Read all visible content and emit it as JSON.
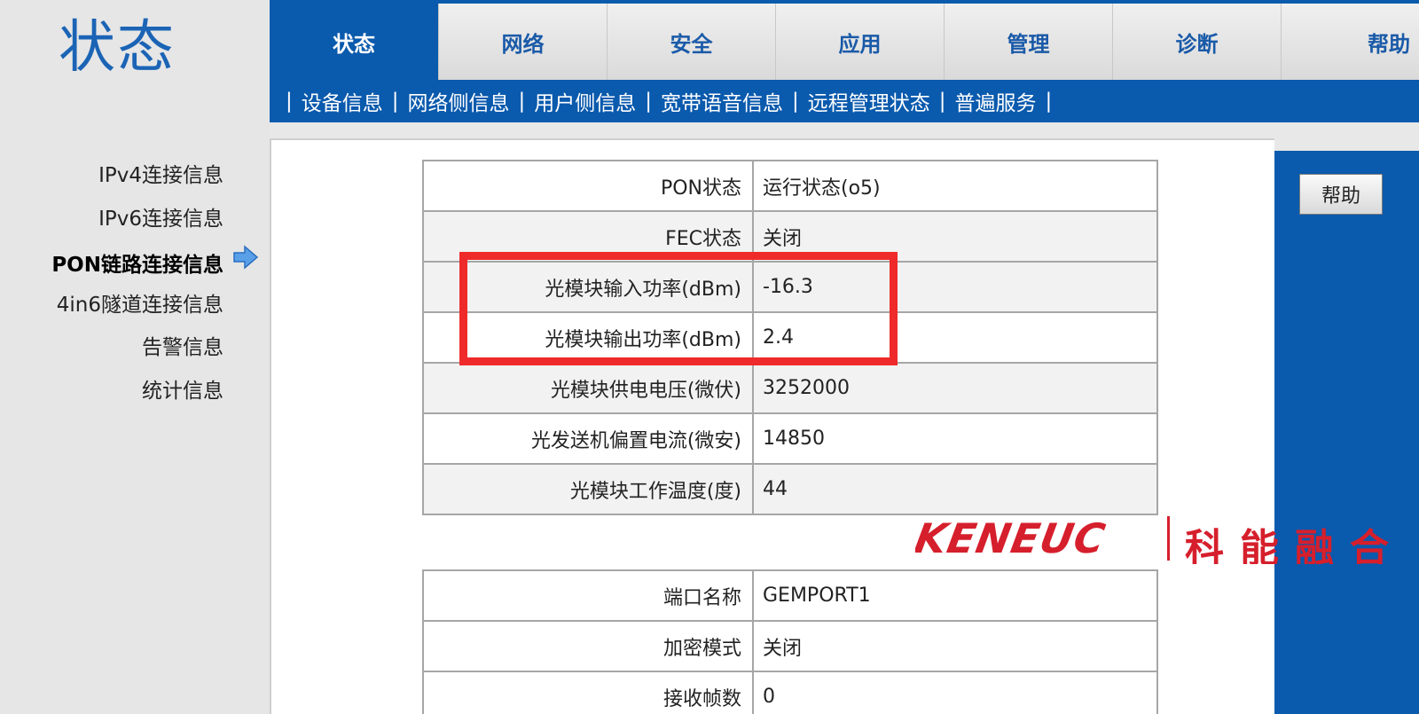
{
  "header": {
    "title": "状态",
    "tabs": [
      {
        "label": "状态",
        "active": true
      },
      {
        "label": "网络",
        "active": false
      },
      {
        "label": "安全",
        "active": false
      },
      {
        "label": "应用",
        "active": false
      },
      {
        "label": "管理",
        "active": false
      },
      {
        "label": "诊断",
        "active": false
      },
      {
        "label": "帮助",
        "active": false
      }
    ],
    "subnav": [
      "设备信息",
      "网络侧信息",
      "用户侧信息",
      "宽带语音信息",
      "远程管理状态",
      "普遍服务"
    ],
    "subnav_separator": "|"
  },
  "sidebar": {
    "items": [
      {
        "label": "IPv4连接信息",
        "active": false
      },
      {
        "label": "IPv6连接信息",
        "active": false
      },
      {
        "label": "PON链路连接信息",
        "active": true
      },
      {
        "label": "4in6隧道连接信息",
        "active": false
      },
      {
        "label": "告警信息",
        "active": false
      },
      {
        "label": "统计信息",
        "active": false
      }
    ],
    "active_indicator_icon": "arrow-right-icon"
  },
  "pon_table": {
    "rows": [
      {
        "label": "PON状态",
        "value": "运行状态(o5)"
      },
      {
        "label": "FEC状态",
        "value": "关闭"
      },
      {
        "label": "光模块输入功率(dBm)",
        "value": "-16.3"
      },
      {
        "label": "光模块输出功率(dBm)",
        "value": "2.4"
      },
      {
        "label": "光模块供电电压(微伏)",
        "value": "3252000"
      },
      {
        "label": "光发送机偏置电流(微安)",
        "value": "14850"
      },
      {
        "label": "光模块工作温度(度)",
        "value": "44"
      }
    ]
  },
  "gem_table": {
    "rows": [
      {
        "label": "端口名称",
        "value": "GEMPORT1"
      },
      {
        "label": "加密模式",
        "value": "关闭"
      },
      {
        "label": "接收帧数",
        "value": "0"
      }
    ]
  },
  "right_panel": {
    "help_button_label": "帮助"
  },
  "watermark": {
    "brand_en": "KENEUC",
    "brand_cn": "科能融合"
  },
  "colors": {
    "primary_blue": "#0a5aad",
    "highlight_red": "#ef2a2a",
    "watermark_red": "#d61f2c"
  }
}
